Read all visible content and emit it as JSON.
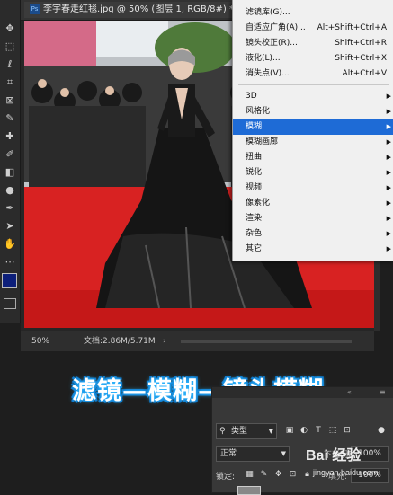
{
  "document": {
    "tab_title": "李宇春走红毯.jpg @ 50% (图层 1, RGB/8#) *",
    "tab_close": "×",
    "zoom": "50%",
    "doc_info": "文档:2.86M/5.71M",
    "status_arrow": "›"
  },
  "toolbar": {
    "tools": [
      "move-icon",
      "marquee-icon",
      "lasso-icon",
      "crop-icon",
      "frame-icon",
      "eyedropper-icon",
      "healing-brush-icon",
      "brush-icon",
      "eraser-icon",
      "burn-icon",
      "pen-icon",
      "path-select-icon",
      "hand-icon",
      "zoom-icon",
      "more-icon"
    ],
    "foreground_color": "#0d1f7a",
    "background_color": "#ffffff"
  },
  "filter_menu": {
    "top_items": [
      {
        "label": "滤镜库(G)...",
        "shortcut": ""
      },
      {
        "label": "自适应广角(A)...",
        "shortcut": "Alt+Shift+Ctrl+A"
      },
      {
        "label": "镜头校正(R)...",
        "shortcut": "Shift+Ctrl+R"
      },
      {
        "label": "液化(L)...",
        "shortcut": "Shift+Ctrl+X"
      },
      {
        "label": "消失点(V)...",
        "shortcut": "Alt+Ctrl+V"
      }
    ],
    "sub_items": [
      {
        "label": "3D"
      },
      {
        "label": "风格化"
      },
      {
        "label": "模糊",
        "highlighted": true
      },
      {
        "label": "模糊画廊"
      },
      {
        "label": "扭曲"
      },
      {
        "label": "锐化"
      },
      {
        "label": "视频"
      },
      {
        "label": "像素化"
      },
      {
        "label": "渲染"
      },
      {
        "label": "杂色"
      },
      {
        "label": "其它"
      }
    ],
    "highlight_color": "#1e6bd6"
  },
  "caption": "滤镜—模糊—镜头模糊",
  "layers_panel": {
    "filter_label": "类型",
    "blend_mode": "正常",
    "opacity_label": "不透明度:",
    "opacity_value": "100%",
    "lock_label": "锁定:",
    "fill_label": "填充:",
    "fill_value": "100%"
  },
  "watermark": {
    "brand": "Bai 经验",
    "url": "jingyan.baidu.com"
  }
}
